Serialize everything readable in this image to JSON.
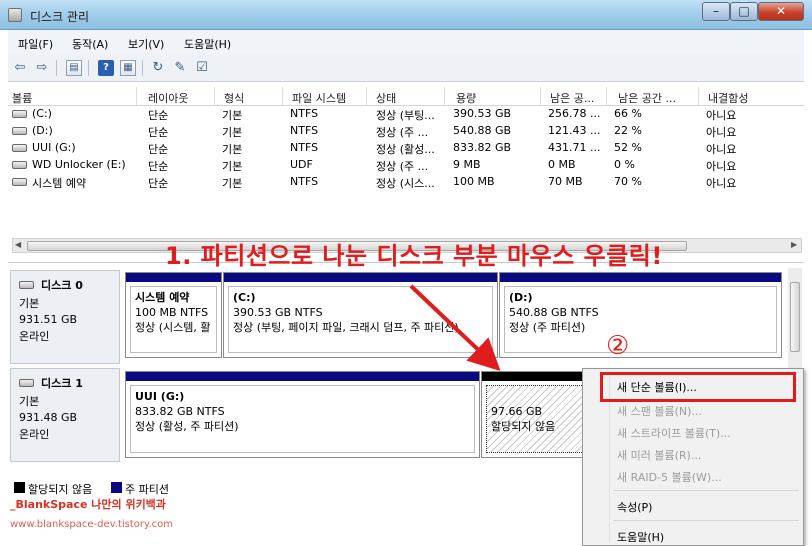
{
  "window": {
    "title": "디스크 관리",
    "min": "–",
    "max": "□",
    "close": "✕"
  },
  "menu": [
    "파일(F)",
    "동작(A)",
    "보기(V)",
    "도움말(H)"
  ],
  "toolbar_icons": [
    "back-arrow",
    "forward-arrow",
    "list-view",
    "help",
    "properties",
    "refresh",
    "settings",
    "disk-check"
  ],
  "columns": [
    "볼륨",
    "레이아웃",
    "형식",
    "파일 시스템",
    "상태",
    "용량",
    "남은 공...",
    "남은 공간 ...",
    "내결함성"
  ],
  "volumes": [
    [
      "(C:)",
      "단순",
      "기본",
      "NTFS",
      "정상 (부팅...",
      "390.53 GB",
      "256.78 ...",
      "66 %",
      "아니요"
    ],
    [
      "(D:)",
      "단순",
      "기본",
      "NTFS",
      "정상 (주 ...",
      "540.88 GB",
      "121.43 ...",
      "22 %",
      "아니요"
    ],
    [
      "UUI (G:)",
      "단순",
      "기본",
      "NTFS",
      "정상 (활성...",
      "833.82 GB",
      "431.71 ...",
      "52 %",
      "아니요"
    ],
    [
      "WD Unlocker (E:)",
      "단순",
      "기본",
      "UDF",
      "정상 (주 ...",
      "9 MB",
      "0 MB",
      "0 %",
      "아니요"
    ],
    [
      "시스템 예약",
      "단순",
      "기본",
      "NTFS",
      "정상 (시스...",
      "100 MB",
      "70 MB",
      "70 %",
      "아니요"
    ]
  ],
  "disks": [
    {
      "name": "디스크 0",
      "type": "기본",
      "size": "931.51 GB",
      "status": "온라인",
      "partitions": [
        {
          "name": "시스템 예약",
          "size": "100 MB NTFS",
          "status": "정상 (시스템, 활"
        },
        {
          "name": "(C:)",
          "size": "390.53 GB NTFS",
          "status": "정상 (부팅, 페이지 파일, 크래시 덤프, 주 파티션)"
        },
        {
          "name": "(D:)",
          "size": "540.88 GB NTFS",
          "status": "정상 (주 파티션)"
        }
      ]
    },
    {
      "name": "디스크 1",
      "type": "기본",
      "size": "931.48 GB",
      "status": "온라인",
      "partitions": [
        {
          "name": "UUI  (G:)",
          "size": "833.82 GB NTFS",
          "status": "정상 (활성, 주 파티션)"
        },
        {
          "name": "",
          "size": "97.66 GB",
          "status": "할당되지 않음"
        }
      ]
    }
  ],
  "legend": {
    "unallocated": "할당되지 않음",
    "primary": "주 파티션",
    "unallocated_color": "#000000",
    "primary_color": "#0a0a80"
  },
  "annotation": {
    "text": "1. 파티션으로 나눈 디스크 부분 마우스 우클릭!",
    "step2": "②",
    "color": "#e01c1c"
  },
  "context_menu": [
    {
      "label": "새 단순 볼륨(I)...",
      "enabled": true
    },
    {
      "label": "새 스팬 볼륨(N)...",
      "enabled": false
    },
    {
      "label": "새 스트라이프 볼륨(T)...",
      "enabled": false
    },
    {
      "label": "새 미러 볼륨(R)...",
      "enabled": false
    },
    {
      "label": "새 RAID-5 볼륨(W)...",
      "enabled": false
    },
    {
      "label": "속성(P)",
      "enabled": true
    },
    {
      "label": "도움말(H)",
      "enabled": true
    }
  ],
  "watermark": {
    "line1": "_BlankSpace 나만의 위키백과",
    "line2": "www.blankspace-dev.tistory.com"
  }
}
